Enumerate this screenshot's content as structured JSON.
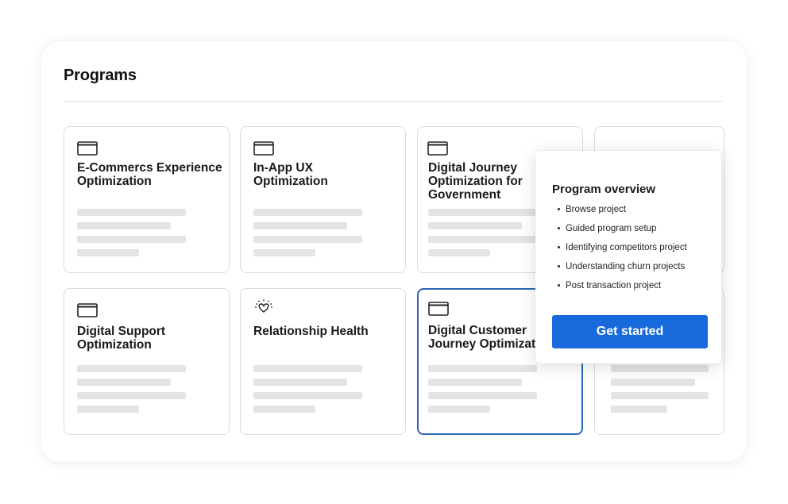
{
  "page": {
    "title": "Programs"
  },
  "programs": [
    {
      "title": "E-Commercs Experience Optimization",
      "icon": "credit-card-icon"
    },
    {
      "title": "In-App UX Optimization",
      "icon": "credit-card-icon"
    },
    {
      "title": "Digital Journey Optimization for Government",
      "icon": "credit-card-icon"
    },
    {
      "title": "Digital Support Optimization",
      "icon": "credit-card-icon"
    },
    {
      "title": "Relationship Health",
      "icon": "heart-sparkle-icon"
    },
    {
      "title": "Digital Customer Journey Optimization",
      "icon": "credit-card-icon",
      "selected": true
    }
  ],
  "overview": {
    "title": "Program overview",
    "items": [
      "Browse project",
      "Guided program setup",
      "Identifying competitors project",
      "Understanding churn projects",
      "Post transaction project"
    ],
    "cta_label": "Get started"
  },
  "colors": {
    "accent": "#1769dc",
    "selected_border": "#2a66b8",
    "skeleton": "#e4e4e4"
  }
}
